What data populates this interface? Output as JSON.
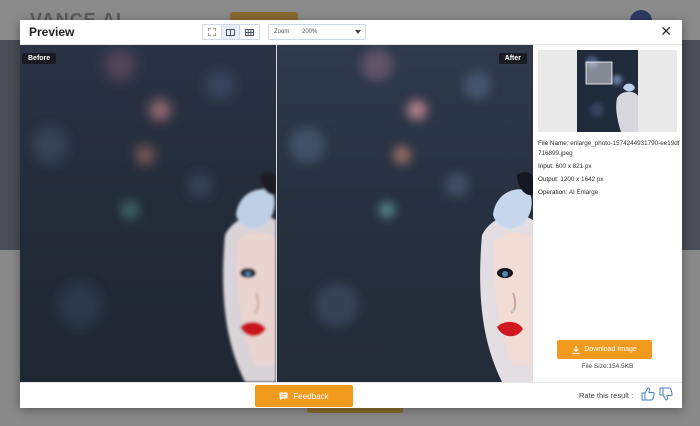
{
  "background_page": {
    "logo": "VANCE AI"
  },
  "modal": {
    "title": "Preview",
    "zoom": {
      "label": "Zoom",
      "value": "200%"
    },
    "close_symbol": "✕",
    "panes": {
      "before_label": "Before",
      "after_label": "After"
    },
    "info": {
      "file_name_label": "File Name:",
      "file_name_value": "enlarge_photo-1574244931790-ee19df716899.jpeg",
      "input_label": "Input:",
      "input_value": "600 x 821 px",
      "output_label": "Output:",
      "output_value": "1200 x 1642 px",
      "operation_label": "Operation:",
      "operation_value": "AI Enlarge"
    },
    "download_label": "Download Image",
    "file_size": "File Size:154.5KB",
    "feedback_label": "Feedback",
    "rate_label": "Rate this result :"
  },
  "colors": {
    "accent_orange": "#f29a1d",
    "photo_background": "#1b2330",
    "lip_red": "#c8141c"
  },
  "icons": [
    "fit-screen-icon",
    "split-view-icon",
    "grid-view-icon",
    "caret-down-icon",
    "close-icon",
    "download-icon",
    "feedback-chat-icon",
    "thumbs-up-icon",
    "thumbs-down-icon"
  ]
}
